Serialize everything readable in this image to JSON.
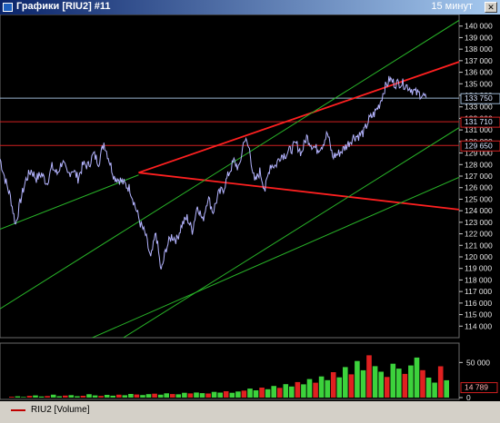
{
  "window": {
    "title": "Графики [RIU2] #11",
    "timeframe": "15 минут"
  },
  "legend": {
    "label": "RIU2 [Volume]",
    "color": "#c00000"
  },
  "colors": {
    "background": "#000000",
    "price_line": "#b4b4ff",
    "trend_red": "#ff2020",
    "channel_green": "#28b428",
    "level_blue": "#9ab4d0",
    "level_red": "#d02020",
    "volume_green": "#3cd23c",
    "volume_red": "#e02020"
  },
  "chart_data": [
    {
      "type": "line",
      "series": [
        {
          "name": "RIU2",
          "x": [
            0,
            6,
            12,
            18,
            24,
            30,
            36,
            42,
            48,
            54,
            60,
            66,
            72,
            78,
            84,
            90,
            96,
            102,
            108,
            114,
            120,
            126,
            132,
            138,
            144,
            150,
            156,
            162,
            168,
            174,
            180,
            186,
            192,
            198,
            204,
            210,
            216,
            222,
            228,
            234,
            240,
            246,
            252,
            258,
            264,
            270,
            276,
            282,
            288,
            294,
            300,
            306,
            312,
            318,
            324,
            330,
            336,
            342,
            348,
            354,
            360,
            366,
            372,
            378,
            384,
            390,
            396,
            402,
            408,
            414,
            420,
            426,
            432,
            438,
            444,
            450,
            456,
            462,
            468,
            474,
            480,
            486,
            492
          ],
          "values": [
            128500,
            126700,
            125200,
            122800,
            125000,
            126700,
            127500,
            126800,
            127200,
            126400,
            127800,
            127200,
            128300,
            127100,
            127600,
            126800,
            128000,
            127900,
            128900,
            128200,
            129900,
            128400,
            126900,
            126700,
            126300,
            125900,
            124400,
            122900,
            121900,
            119800,
            122100,
            118700,
            120800,
            121800,
            121500,
            122800,
            123400,
            122300,
            124500,
            123100,
            125200,
            123900,
            125400,
            125900,
            127200,
            128300,
            127600,
            130300,
            129300,
            126400,
            127400,
            125800,
            128000,
            127900,
            128800,
            128900,
            129300,
            129800,
            129000,
            130400,
            129700,
            129300,
            129700,
            130700,
            128700,
            128900,
            129300,
            129800,
            130400,
            130500,
            130800,
            131900,
            132400,
            133200,
            134600,
            135400,
            135000,
            135100,
            134900,
            134600,
            134200,
            134100,
            133800
          ]
        }
      ],
      "y_ticks": [
        "140 000",
        "139 000",
        "138 000",
        "137 000",
        "136 000",
        "135 000",
        "134 000",
        "133 000",
        "132 000",
        "131 000",
        "130 000",
        "129 000",
        "128 000",
        "127 000",
        "126 000",
        "125 000",
        "124 000",
        "123 000",
        "122 000",
        "121 000",
        "120 000",
        "119 000",
        "118 000",
        "117 000",
        "116 000",
        "115 000",
        "114 000"
      ],
      "ylim": [
        113000,
        141000
      ],
      "levels": [
        {
          "value": 133750,
          "label": "133 750",
          "color": "#9ab4d0"
        },
        {
          "value": 131710,
          "label": "131 710",
          "color": "#d02020"
        },
        {
          "value": 129650,
          "label": "129 650",
          "color": "#d02020"
        }
      ],
      "trendlines": [
        {
          "x1": 160,
          "y1": 127300,
          "x2": 530,
          "y2": 136900,
          "color": "#ff2020"
        },
        {
          "x1": 160,
          "y1": 127300,
          "x2": 530,
          "y2": 124100,
          "color": "#ff2020"
        },
        {
          "x1": 0,
          "y1": 115500,
          "x2": 530,
          "y2": 140500,
          "color": "#28b428"
        },
        {
          "x1": 100,
          "y1": 111000,
          "x2": 530,
          "y2": 131200,
          "color": "#28b428"
        },
        {
          "x1": 0,
          "y1": 109500,
          "x2": 530,
          "y2": 126900,
          "color": "#28b428"
        },
        {
          "x1": 0,
          "y1": 122400,
          "x2": 160,
          "y2": 127100,
          "color": "#28b428"
        }
      ]
    },
    {
      "type": "bar",
      "series": [
        {
          "name": "RIU2 [Volume]",
          "values": [
            1200,
            1800,
            900,
            2500,
            3100,
            1500,
            2200,
            4200,
            1900,
            2800,
            3500,
            2000,
            2600,
            4800,
            3100,
            2300,
            3900,
            2700,
            4100,
            3300,
            5200,
            4400,
            3600,
            4900,
            5600,
            4200,
            6100,
            5100,
            4700,
            6800,
            5900,
            7300,
            6400,
            5800,
            8200,
            7100,
            9100,
            6800,
            8700,
            9900,
            12800,
            10400,
            14200,
            11900,
            16500,
            13800,
            19200,
            15800,
            22100,
            18900,
            26400,
            21200,
            30100,
            24800,
            36200,
            28900,
            43500,
            33100,
            52100,
            38900,
            60200,
            44800,
            36800,
            29400,
            48200,
            41200,
            33800,
            45800,
            57000,
            39000,
            28500,
            21300,
            44600,
            24700
          ]
        }
      ],
      "y_ticks": [
        "50 000",
        "0"
      ],
      "current_label": "14 789",
      "ylim": [
        0,
        75000
      ]
    }
  ]
}
